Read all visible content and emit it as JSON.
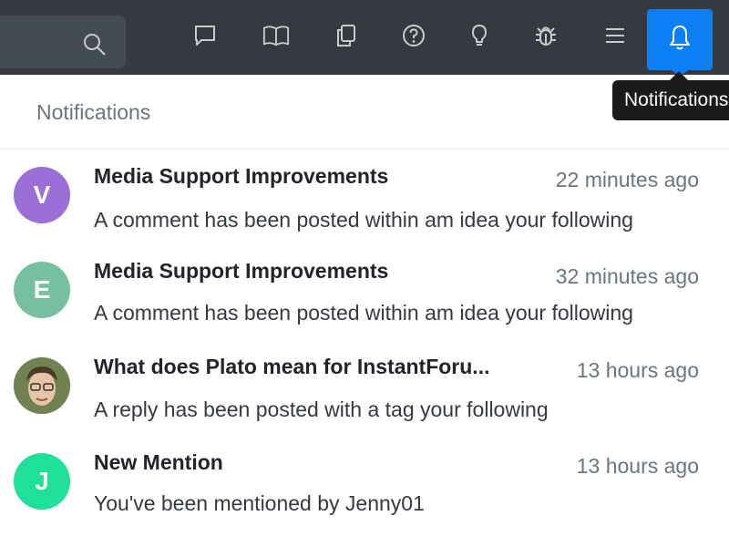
{
  "toolbar": {
    "search_placeholder": "",
    "icons": [
      "chat-icon",
      "book-icon",
      "copy-icon",
      "help-icon",
      "lightbulb-icon",
      "bug-icon",
      "menu-icon",
      "bell-icon"
    ],
    "active_color": "#0d7ff5"
  },
  "tooltip": {
    "text": "Notifications"
  },
  "panel": {
    "title": "Notifications"
  },
  "notifications": [
    {
      "avatar_letter": "V",
      "avatar_color": "#9b6fd6",
      "title": "Media Support Improvements",
      "time": "22 minutes ago",
      "body": "A comment has been posted within am idea your following"
    },
    {
      "avatar_letter": "E",
      "avatar_color": "#74c0a0",
      "title": "Media Support Improvements",
      "time": "32 minutes ago",
      "body": "A comment has been posted within am idea your following"
    },
    {
      "avatar_letter": "",
      "avatar_color": "#7a8a5a",
      "title": "What does Plato mean for InstantForu...",
      "time": "13 hours ago",
      "body": "A reply has been posted with a tag your following"
    },
    {
      "avatar_letter": "J",
      "avatar_color": "#1ee09a",
      "title": "New Mention",
      "time": "13 hours ago",
      "body": "You've been mentioned by Jenny01"
    }
  ]
}
